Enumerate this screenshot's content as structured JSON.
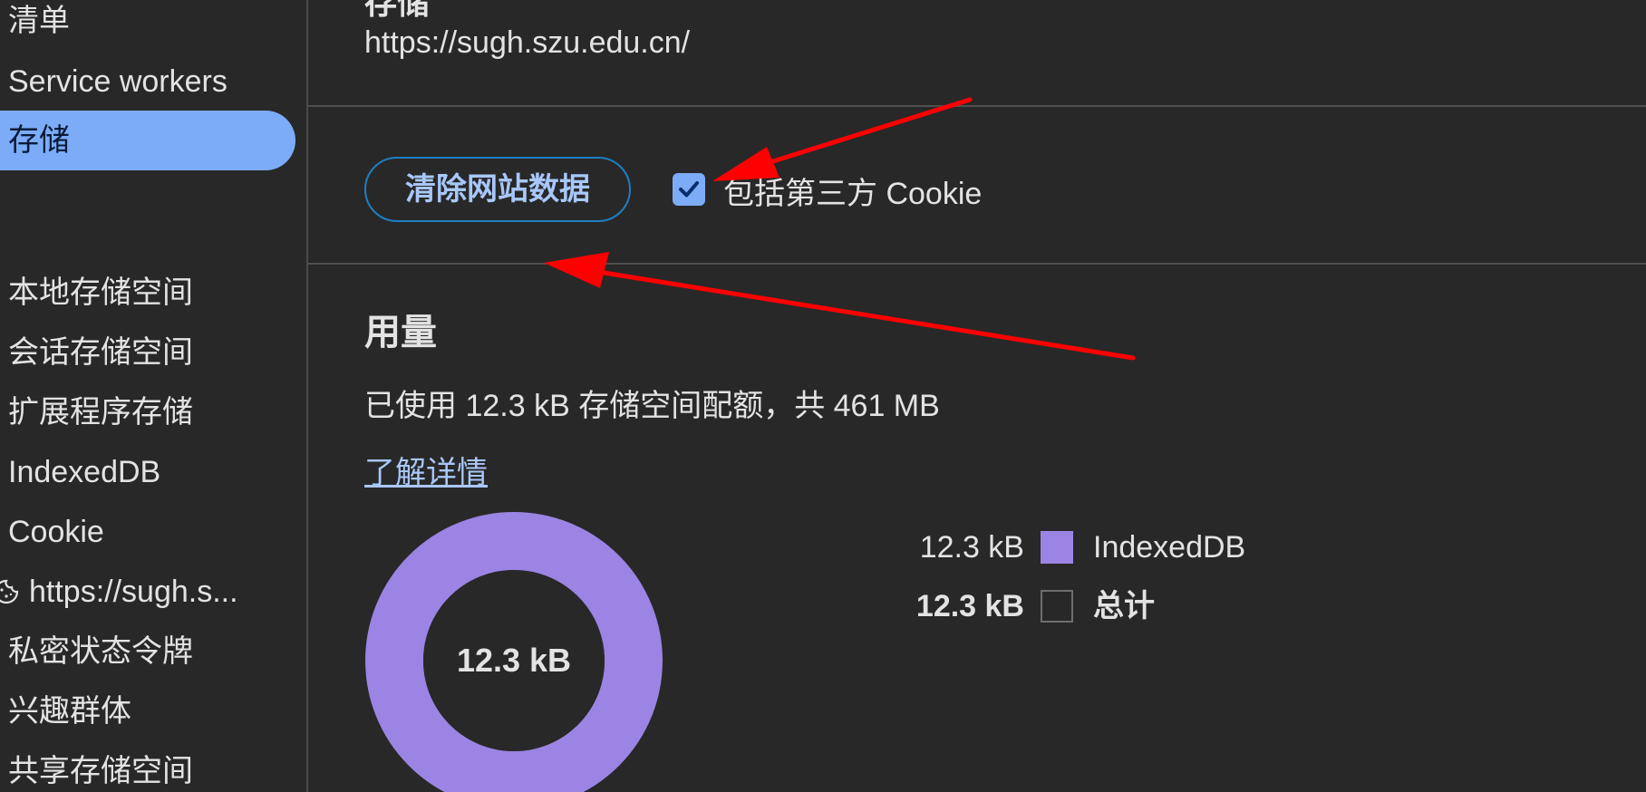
{
  "sidebar": {
    "items": [
      {
        "label": "清单"
      },
      {
        "label": "Service workers"
      },
      {
        "label": "存储",
        "selected": true
      },
      {
        "label": "本地存储空间"
      },
      {
        "label": "会话存储空间"
      },
      {
        "label": "扩展程序存储"
      },
      {
        "label": "IndexedDB"
      },
      {
        "label": "Cookie"
      },
      {
        "label": "https://sugh.s...",
        "icon": "cookie-icon"
      },
      {
        "label": "私密状态令牌"
      },
      {
        "label": "兴趣群体"
      },
      {
        "label": "共享存储空间"
      }
    ]
  },
  "main": {
    "section_heading": "存储",
    "origin_url": "https://sugh.szu.edu.cn/",
    "clear_button_label": "清除网站数据",
    "include_third_party": {
      "checked": true,
      "label": "包括第三方 Cookie"
    },
    "usage": {
      "heading": "用量",
      "summary": "已使用 12.3 kB 存储空间配额，共 461 MB",
      "learn_more": "了解详情",
      "donut_center": "12.3 kB",
      "legend": [
        {
          "value": "12.3 kB",
          "label": "IndexedDB",
          "color": "#9b84e4",
          "bold": false
        },
        {
          "value": "12.3 kB",
          "label": "总计",
          "color": "transparent",
          "bold": true
        }
      ]
    }
  },
  "colors": {
    "background": "#282828",
    "selected_nav": "#7cacf8",
    "accent_link": "#a8c7fa",
    "button_border": "#1f7fc2",
    "donut_fill": "#9b84e4",
    "annotation_arrow": "#ff0000"
  }
}
